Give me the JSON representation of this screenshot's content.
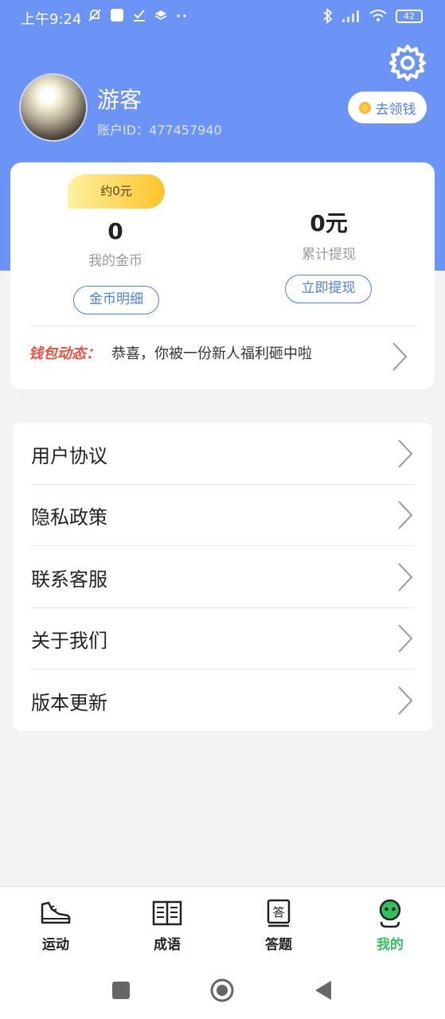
{
  "status_bar": {
    "time": "上午9:24",
    "battery": "42"
  },
  "profile": {
    "name": "游客",
    "account_label": "账户ID：",
    "account_id": "477457940",
    "go_money_label": "去领钱"
  },
  "wallet": {
    "approx_badge": "约0元",
    "coins_value": "0",
    "coins_label": "我的金币",
    "coin_detail_button": "金币明细",
    "withdrawn_value": "0元",
    "withdrawn_label": "累计提现",
    "withdraw_button": "立即提现",
    "news_title": "钱包动态：",
    "news_text": "恭喜，你被一份新人福利砸中啦"
  },
  "menu": {
    "items": [
      {
        "label": "用户协议"
      },
      {
        "label": "隐私政策"
      },
      {
        "label": "联系客服"
      },
      {
        "label": "关于我们"
      },
      {
        "label": "版本更新"
      }
    ]
  },
  "tabs": [
    {
      "label": "运动",
      "icon": "sneaker-icon"
    },
    {
      "label": "成语",
      "icon": "open-book-icon"
    },
    {
      "label": "答题",
      "icon": "answer-book-icon"
    },
    {
      "label": "我的",
      "icon": "profile-face-icon",
      "active": true
    }
  ],
  "colors": {
    "header_blue": "#6c93f6",
    "accent_blue": "#4d7ff0",
    "active_green": "#34c05d",
    "news_red": "#ef4f40"
  }
}
